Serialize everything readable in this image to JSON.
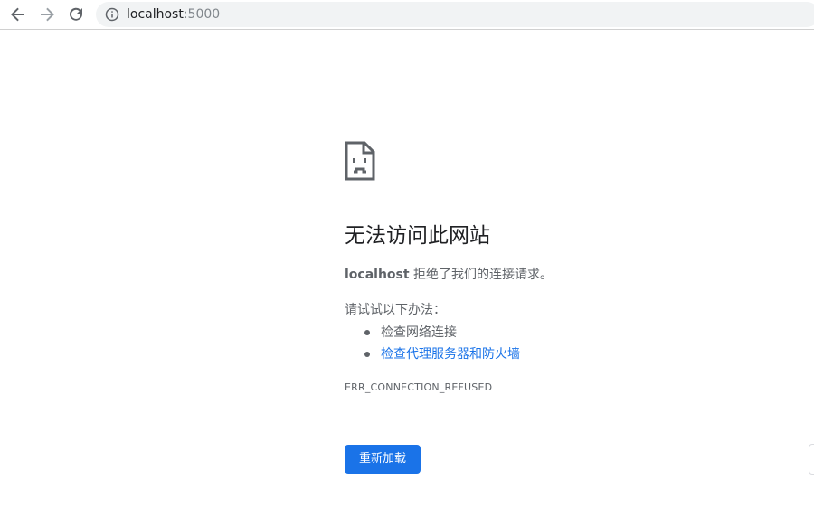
{
  "browser": {
    "url_host": "localhost",
    "url_port": ":5000",
    "icons": {
      "back": "arrow-left-icon",
      "forward": "arrow-right-icon",
      "reload": "reload-icon",
      "info": "info-icon"
    }
  },
  "error_page": {
    "icon": "sad-page-icon",
    "title": "无法访问此网站",
    "desc_host": "localhost",
    "desc_text": " 拒绝了我们的连接请求。",
    "try_label": "请试试以下办法：",
    "suggestions": [
      {
        "label": "检查网络连接",
        "link": false
      },
      {
        "label": "检查代理服务器和防火墙",
        "link": true
      }
    ],
    "error_code": "ERR_CONNECTION_REFUSED",
    "reload_label": "重新加载"
  },
  "colors": {
    "accent": "#1a73e8",
    "text_primary": "#202124",
    "text_secondary": "#5f6368"
  }
}
